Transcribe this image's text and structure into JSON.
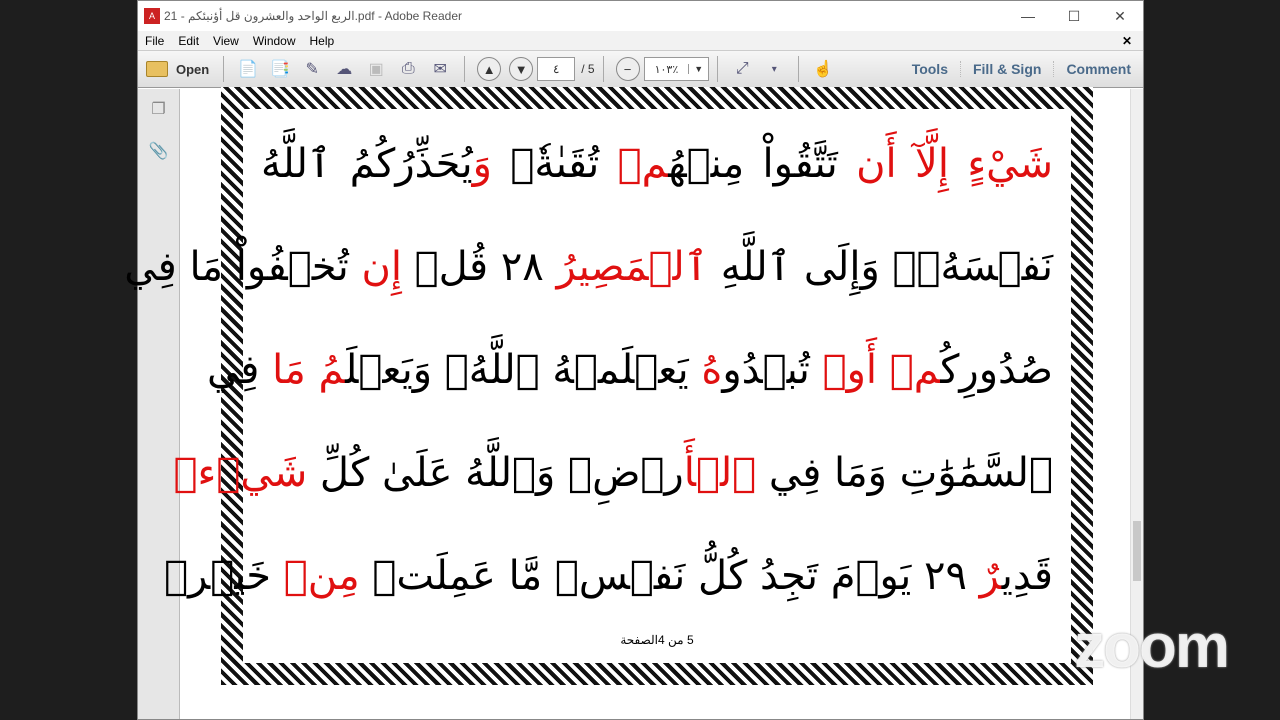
{
  "window": {
    "title": "الربع  الواحد والعشرون  قل أؤنبئكم - 21.pdf - Adobe Reader",
    "controls": [
      "—",
      "☐",
      "✕"
    ]
  },
  "menu": [
    "File",
    "Edit",
    "View",
    "Window",
    "Help"
  ],
  "toolbar": {
    "open": "Open",
    "page_current": "٤",
    "page_total": "/ 5",
    "zoom": "١٠٣٪",
    "tools": "Tools",
    "fill_sign": "Fill & Sign",
    "comment": "Comment"
  },
  "lines": [
    [
      {
        "t": "شَيْءٍ ",
        "r": true
      },
      {
        "t": "إِلَّآ ",
        "r": true
      },
      {
        "t": "أَن ",
        "r": true
      },
      {
        "t": "تَتَّقُواْ مِنۡهُ",
        "r": false
      },
      {
        "t": "مۡ ",
        "r": true
      },
      {
        "t": "تُقَىٰةٗۗ ",
        "r": false
      },
      {
        "t": "وَ",
        "r": true
      },
      {
        "t": "يُحَذِّرُكُمُ ٱللَّهُ",
        "r": false
      }
    ],
    [
      {
        "t": "نَفۡسَهُۥۗ وَإِلَى ٱللَّهِ ",
        "r": false
      },
      {
        "t": "ٱلۡمَصِيرُ ",
        "r": true
      },
      {
        "t": "٢٨ قُلۡ ",
        "r": false
      },
      {
        "t": "إِن ",
        "r": true
      },
      {
        "t": "تُخۡفُواْ مَا فِي",
        "r": false
      }
    ],
    [
      {
        "t": "صُدُورِكُ",
        "r": false
      },
      {
        "t": "مۡ ",
        "r": true
      },
      {
        "t": "أَوۡ ",
        "r": true
      },
      {
        "t": "تُبۡدُو",
        "r": false
      },
      {
        "t": "هُ ",
        "r": true
      },
      {
        "t": "يَعۡلَمۡهُ ٱللَّهُۗ وَيَعۡلَ",
        "r": false
      },
      {
        "t": "مُ مَا ",
        "r": true
      },
      {
        "t": "فِي",
        "r": false
      }
    ],
    [
      {
        "t": "ٱلسَّمَٰوَٰتِ وَمَا فِي ",
        "r": false
      },
      {
        "t": "ٱلۡأَ",
        "r": true
      },
      {
        "t": "رۡضِۗ وَٱللَّهُ عَلَىٰ كُلِّ ",
        "r": false
      },
      {
        "t": "شَيۡءٖ",
        "r": true
      }
    ],
    [
      {
        "t": "قَدِي",
        "r": false
      },
      {
        "t": "رٌ ",
        "r": true
      },
      {
        "t": "٢٩ يَوۡمَ تَجِدُ كُلُّ نَفۡسٖ مَّا عَمِلَتۡ ",
        "r": false
      },
      {
        "t": "مِنۡ ",
        "r": true
      },
      {
        "t": "خَيۡرٖ",
        "r": false
      }
    ]
  ],
  "footer": "5 من 4الصفحة",
  "watermark": "zoom"
}
